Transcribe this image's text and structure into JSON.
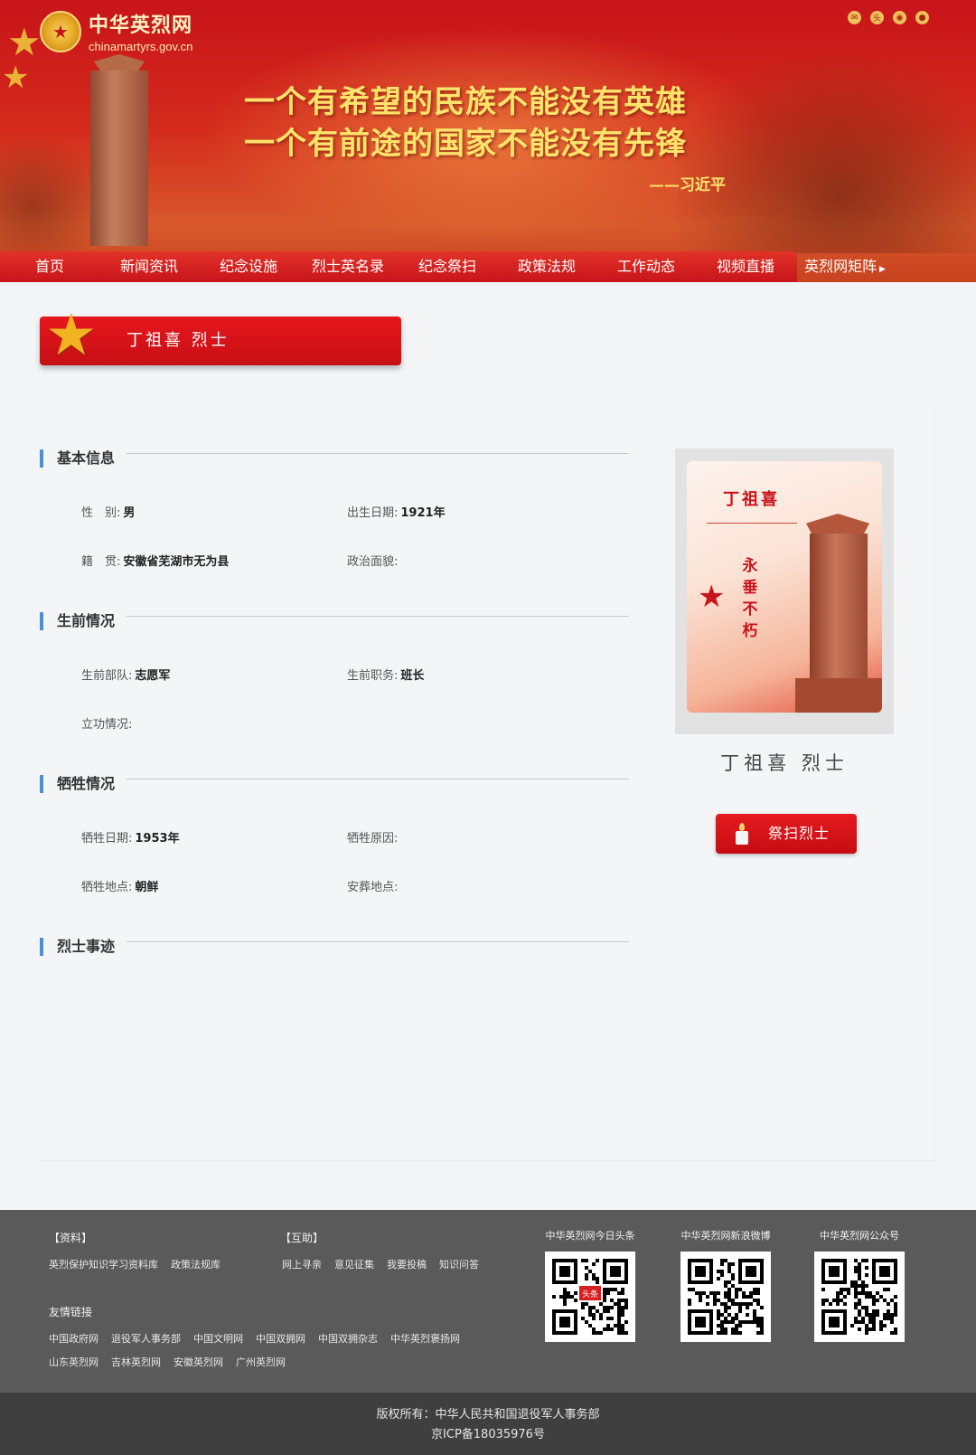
{
  "site": {
    "name_cn": "中华英烈网",
    "domain": "chinamartyrs.gov.cn",
    "slogan_line1": "一个有希望的民族不能没有英雄",
    "slogan_line2": "一个有前途的国家不能没有先锋",
    "signature": "——习近平"
  },
  "header_icons": [
    "mail-icon",
    "toutiao-icon",
    "weibo-icon",
    "wechat-icon"
  ],
  "nav": {
    "items": [
      "首页",
      "新闻资讯",
      "纪念设施",
      "烈士英名录",
      "纪念祭扫",
      "政策法规",
      "工作动态",
      "视频直播"
    ],
    "more": "英烈网矩阵"
  },
  "title_banner": {
    "name": "丁祖喜 烈士"
  },
  "sections": {
    "basic": {
      "title": "基本信息",
      "gender_label": "性　别:",
      "gender_value": "男",
      "birth_label": "出生日期:",
      "birth_value": "1921年",
      "hometown_label": "籍　贯:",
      "hometown_value": "安徽省芜湖市无为县",
      "political_label": "政治面貌:",
      "political_value": ""
    },
    "life": {
      "title": "生前情况",
      "unit_label": "生前部队:",
      "unit_value": "志愿军",
      "post_label": "生前职务:",
      "post_value": "班长",
      "merit_label": "立功情况:",
      "merit_value": ""
    },
    "sacrifice": {
      "title": "牺牲情况",
      "date_label": "牺牲日期:",
      "date_value": "1953年",
      "reason_label": "牺牲原因:",
      "reason_value": "",
      "place_label": "牺牲地点:",
      "place_value": "朝鲜",
      "burial_label": "安葬地点:",
      "burial_value": ""
    },
    "deeds": {
      "title": "烈士事迹"
    }
  },
  "portrait": {
    "poster_name": "丁祖喜",
    "poster_motto": [
      "永",
      "垂",
      "不",
      "朽"
    ],
    "hero_name": "丁祖喜 烈士",
    "tribute_label": "祭扫烈士"
  },
  "footer": {
    "resources_title": "【资料】",
    "resources_links": [
      "英烈保护知识学习资料库",
      "政策法规库"
    ],
    "interact_title": "【互助】",
    "interact_links": [
      "网上寻亲",
      "意见征集",
      "我要投稿",
      "知识问答"
    ],
    "friends_title": "友情链接",
    "friends_row1": [
      "中国政府网",
      "退役军人事务部",
      "中国文明网",
      "中国双拥网",
      "中国双拥杂志",
      "中华英烈褒扬网"
    ],
    "friends_row2": [
      "山东英烈网",
      "吉林英烈网",
      "安徽英烈网",
      "广州英烈网"
    ],
    "qr": [
      {
        "caption": "中华英烈网今日头条",
        "badge": "头条"
      },
      {
        "caption": "中华英烈网新浪微博",
        "badge": ""
      },
      {
        "caption": "中华英烈网公众号",
        "badge": ""
      }
    ]
  },
  "copyright": {
    "line1": "版权所有：中华人民共和国退役军人事务部",
    "line2": "京ICP备18035976号"
  }
}
